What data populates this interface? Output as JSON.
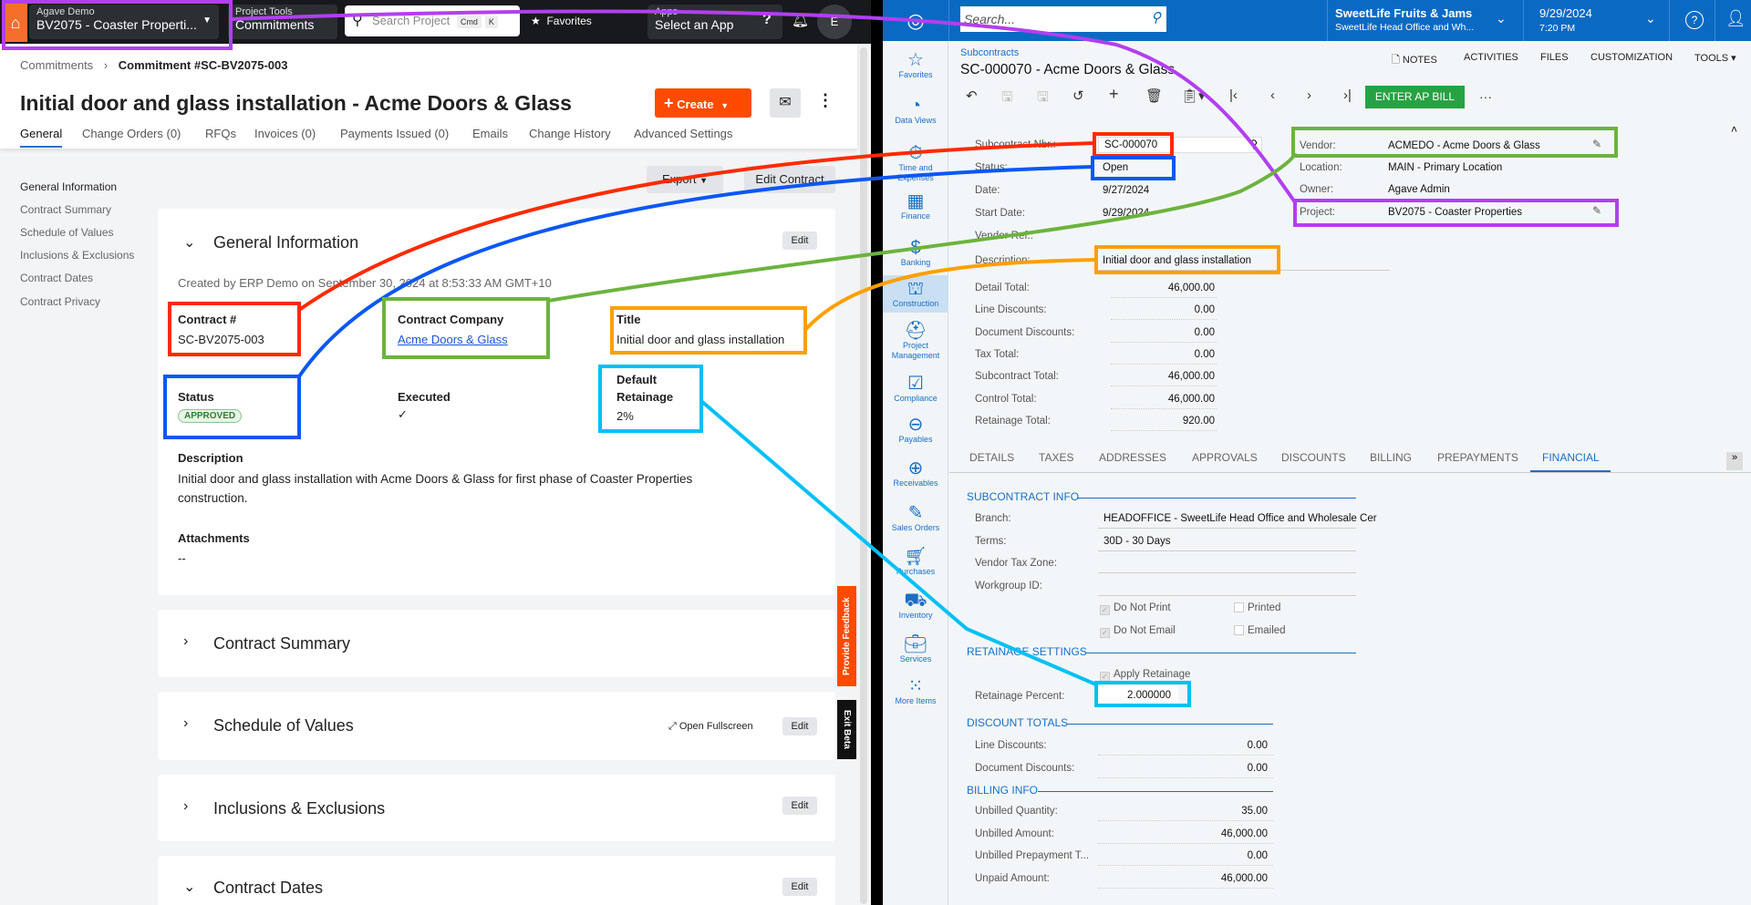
{
  "left_app": {
    "top": {
      "company_small": "Agave Demo",
      "project": "BV2075 - Coaster Properti...",
      "tools_small": "Project Tools",
      "tools": "Commitments",
      "search_placeholder": "Search Project",
      "kbd1": "Cmd",
      "kbd2": "K",
      "favorites": "Favorites",
      "apps_small": "Apps",
      "apps": "Select an App",
      "avatar": "E"
    },
    "breadcrumb": {
      "parent": "Commitments",
      "current": "Commitment #SC-BV2075-003"
    },
    "title": "Initial door and glass installation - Acme Doors & Glass",
    "create_label": "Create",
    "tabs": [
      "General",
      "Change Orders (0)",
      "RFQs",
      "Invoices (0)",
      "Payments Issued (0)",
      "Emails",
      "Change History",
      "Advanced Settings"
    ],
    "export_label": "Export",
    "edit_contract_label": "Edit Contract",
    "side_nav": [
      "General Information",
      "Contract Summary",
      "Schedule of Values",
      "Inclusions & Exclusions",
      "Contract Dates",
      "Contract Privacy"
    ],
    "general": {
      "heading": "General Information",
      "edit": "Edit",
      "created": "Created by ERP Demo on September 30, 2024 at 8:53:33 AM GMT+10",
      "contract_no_label": "Contract #",
      "contract_no": "SC-BV2075-003",
      "company_label": "Contract Company",
      "company": "Acme Doors & Glass",
      "title_label": "Title",
      "title": "Initial door and glass installation",
      "status_label": "Status",
      "status": "APPROVED",
      "executed_label": "Executed",
      "executed": "✓",
      "retainage_label1": "Default",
      "retainage_label2": "Retainage",
      "retainage": "2%",
      "description_label": "Description",
      "description1": "Initial door and glass installation with Acme Doors & Glass for first phase of Coaster Properties",
      "description2": "construction.",
      "attachments_label": "Attachments",
      "attachments": "--"
    },
    "sections": [
      {
        "title": "Contract Summary"
      },
      {
        "title": "Schedule of Values",
        "extra": "Open Fullscreen",
        "edit": "Edit"
      },
      {
        "title": "Inclusions & Exclusions",
        "edit": "Edit"
      },
      {
        "title": "Contract Dates",
        "edit": "Edit"
      }
    ],
    "feedback_tab": "Provide Feedback",
    "exit_beta": "Exit Beta"
  },
  "right_app": {
    "search_placeholder": "Search...",
    "company": "SweetLife Fruits & Jams",
    "branch": "SweetLife Head Office and Wh...",
    "date": "9/29/2024",
    "time": "7:20 PM",
    "nav": [
      "Favorites",
      "Data Views",
      "Time and Expenses",
      "Finance",
      "Banking",
      "Construction",
      "Project Management",
      "Compliance",
      "Payables",
      "Receivables",
      "Sales Orders",
      "Purchases",
      "Inventory",
      "Services",
      "More Items"
    ],
    "breadcrumb": "Subcontracts",
    "title": "SC-000070 - Acme Doors & Glass",
    "top_links": [
      "NOTES",
      "ACTIVITIES",
      "FILES",
      "CUSTOMIZATION",
      "TOOLS"
    ],
    "enter_ap_bill": "ENTER AP BILL",
    "form": {
      "subcontract_nbr_label": "Subcontract Nbr.:",
      "subcontract_nbr": "SC-000070",
      "status_label": "Status:",
      "status": "Open",
      "date_label": "Date:",
      "date": "9/27/2024",
      "start_label": "Start Date:",
      "start": "9/29/2024",
      "vendor_ref_label": "Vendor Ref.:",
      "description_label": "Description:",
      "description": "Initial door and glass installation",
      "vendor_label": "Vendor:",
      "vendor": "ACMEDO - Acme Doors & Glass",
      "location_label": "Location:",
      "location": "MAIN - Primary Location",
      "owner_label": "Owner:",
      "owner": "Agave Admin",
      "project_label": "Project:",
      "project": "BV2075 - Coaster Properties"
    },
    "totals": [
      {
        "label": "Detail Total:",
        "value": "46,000.00"
      },
      {
        "label": "Line Discounts:",
        "value": "0.00"
      },
      {
        "label": "Document Discounts:",
        "value": "0.00"
      },
      {
        "label": "Tax Total:",
        "value": "0.00"
      },
      {
        "label": "Subcontract Total:",
        "value": "46,000.00"
      },
      {
        "label": "Control Total:",
        "value": "46,000.00"
      },
      {
        "label": "Retainage Total:",
        "value": "920.00"
      }
    ],
    "tabs": [
      "DETAILS",
      "TAXES",
      "ADDRESSES",
      "APPROVALS",
      "DISCOUNTS",
      "BILLING",
      "PREPAYMENTS",
      "FINANCIAL"
    ],
    "subcontract_info": {
      "heading": "SUBCONTRACT INFO",
      "rows": [
        {
          "label": "Branch:",
          "value": "HEADOFFICE - SweetLife Head Office and Wholesale Cer"
        },
        {
          "label": "Terms:",
          "value": "30D - 30 Days"
        },
        {
          "label": "Vendor Tax Zone:",
          "value": ""
        },
        {
          "label": "Workgroup ID:",
          "value": ""
        }
      ],
      "do_not_print": "Do Not Print",
      "printed": "Printed",
      "do_not_email": "Do Not Email",
      "emailed": "Emailed"
    },
    "retainage": {
      "heading": "RETAINAGE SETTINGS",
      "apply": "Apply Retainage",
      "percent_label": "Retainage Percent:",
      "percent": "2.000000"
    },
    "discount_totals": {
      "heading": "DISCOUNT TOTALS",
      "rows": [
        {
          "label": "Line Discounts:",
          "value": "0.00"
        },
        {
          "label": "Document Discounts:",
          "value": "0.00"
        }
      ]
    },
    "billing_info": {
      "heading": "BILLING INFO",
      "rows": [
        {
          "label": "Unbilled Quantity:",
          "value": "35.00"
        },
        {
          "label": "Unbilled Amount:",
          "value": "46,000.00"
        },
        {
          "label": "Unbilled Prepayment T...",
          "value": "0.00"
        },
        {
          "label": "Unpaid Amount:",
          "value": "46,000.00"
        }
      ]
    }
  },
  "annotation_colors": {
    "project": "#b23ff0",
    "contract_no": "#ff2a00",
    "status": "#0a57f5",
    "vendor": "#6cb33f",
    "title": "#ff9f00",
    "retainage": "#00c0f5"
  }
}
